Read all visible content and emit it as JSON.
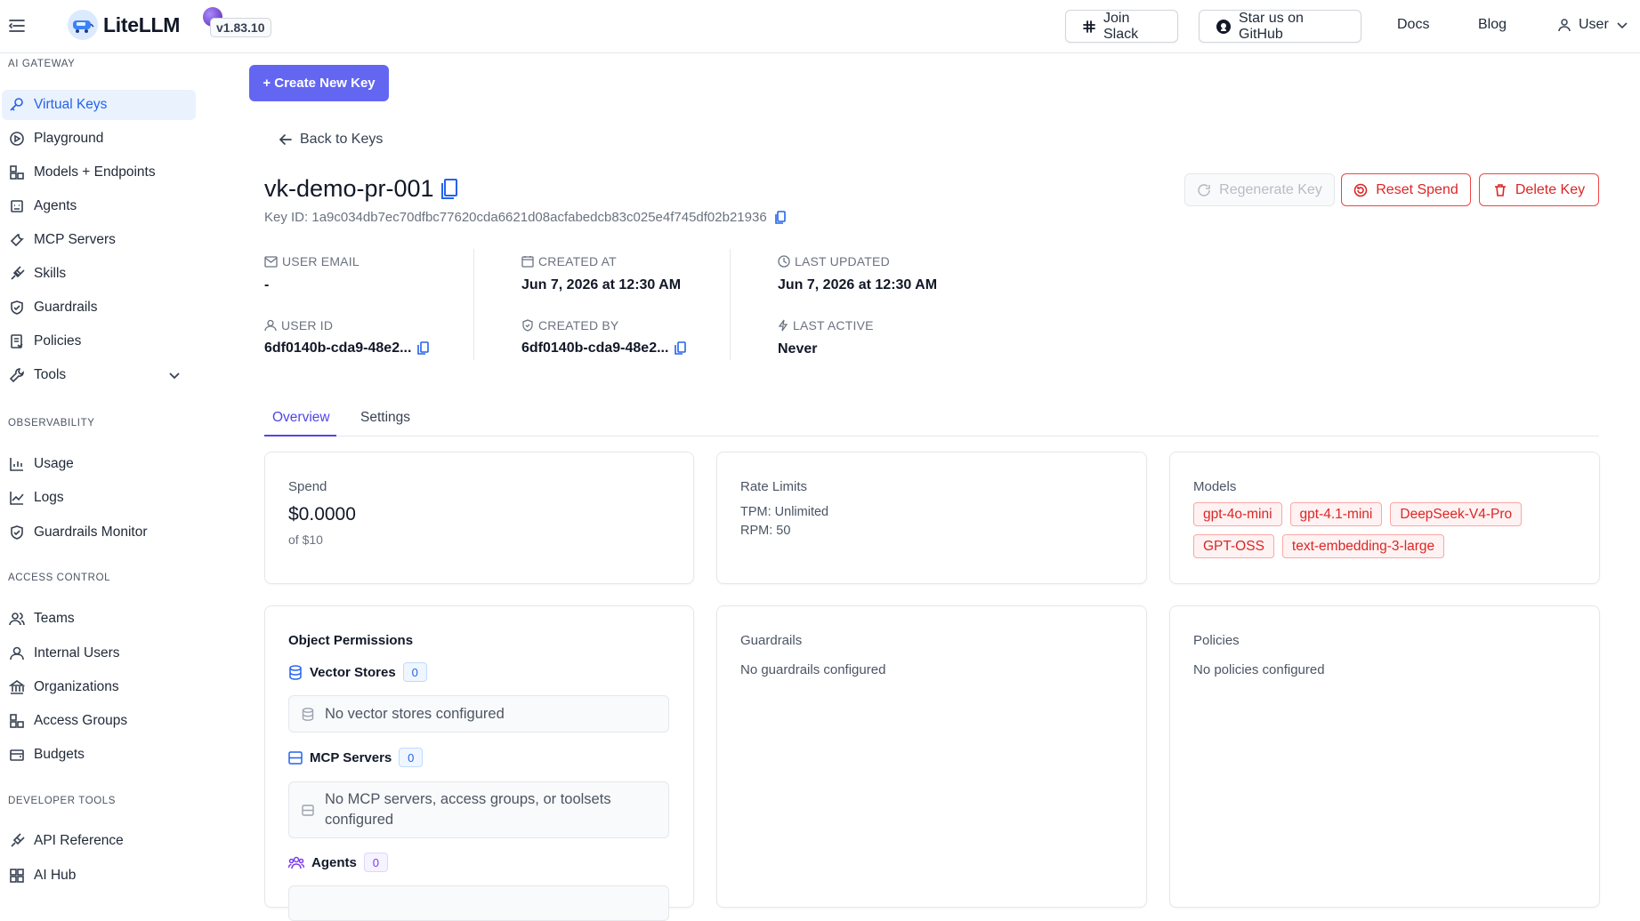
{
  "header": {
    "app_name": "LiteLLM",
    "version": "v1.83.10",
    "join_slack": "Join Slack",
    "star_github": "Star us on GitHub",
    "docs": "Docs",
    "blog": "Blog",
    "user": "User"
  },
  "sidebar": {
    "sections": {
      "gateway": "AI GATEWAY",
      "observability": "OBSERVABILITY",
      "access": "ACCESS CONTROL",
      "developer": "DEVELOPER TOOLS"
    },
    "items": {
      "virtual_keys": "Virtual Keys",
      "playground": "Playground",
      "models": "Models + Endpoints",
      "agents": "Agents",
      "mcp_servers": "MCP Servers",
      "skills": "Skills",
      "guardrails": "Guardrails",
      "policies": "Policies",
      "tools": "Tools",
      "usage": "Usage",
      "logs": "Logs",
      "guardrails_monitor": "Guardrails Monitor",
      "teams": "Teams",
      "internal_users": "Internal Users",
      "organizations": "Organizations",
      "access_groups": "Access Groups",
      "budgets": "Budgets",
      "api_reference": "API Reference",
      "ai_hub": "AI Hub"
    },
    "active": "virtual_keys"
  },
  "main": {
    "create_key": "+ Create New Key",
    "back": "Back to Keys",
    "key_name": "vk-demo-pr-001",
    "key_id": "Key ID: 1a9c034db7ec70dfbc77620cda6621d08acfabedcb83c025e4f745df02b21936",
    "actions": {
      "regenerate": "Regenerate Key",
      "reset_spend": "Reset Spend",
      "delete": "Delete Key"
    },
    "meta": {
      "user_email_label": "USER EMAIL",
      "user_email": "-",
      "user_id_label": "USER ID",
      "user_id": "6df0140b-cda9-48e2...",
      "created_at_label": "CREATED AT",
      "created_at": "Jun 7, 2026 at 12:30 AM",
      "created_by_label": "CREATED BY",
      "created_by": "6df0140b-cda9-48e2...",
      "last_updated_label": "LAST UPDATED",
      "last_updated": "Jun 7, 2026 at 12:30 AM",
      "last_active_label": "LAST ACTIVE",
      "last_active": "Never"
    },
    "tabs": [
      "Overview",
      "Settings"
    ],
    "active_tab": "Overview",
    "spend": {
      "title": "Spend",
      "value": "$0.0000",
      "of": "of $10"
    },
    "rate_limits": {
      "title": "Rate Limits",
      "tpm": "TPM: Unlimited",
      "rpm": "RPM: 50"
    },
    "models": {
      "title": "Models",
      "tags": [
        "gpt-4o-mini",
        "gpt-4.1-mini",
        "DeepSeek-V4-Pro",
        "GPT-OSS",
        "text-embedding-3-large"
      ]
    },
    "object_permissions": {
      "title": "Object Permissions",
      "vector_stores": {
        "label": "Vector Stores",
        "count": "0",
        "empty": "No vector stores configured"
      },
      "mcp_servers": {
        "label": "MCP Servers",
        "count": "0",
        "empty": "No MCP servers, access groups, or toolsets configured"
      },
      "agents": {
        "label": "Agents",
        "count": "0"
      }
    },
    "guardrails": {
      "title": "Guardrails",
      "empty": "No guardrails configured"
    },
    "policies": {
      "title": "Policies",
      "empty": "No policies configured"
    }
  },
  "colors": {
    "accent": "#4f46e5",
    "primary_button": "#6366f1",
    "danger": "#dc2626",
    "active_nav_bg": "#eaf2fe",
    "link_blue": "#2563eb"
  }
}
